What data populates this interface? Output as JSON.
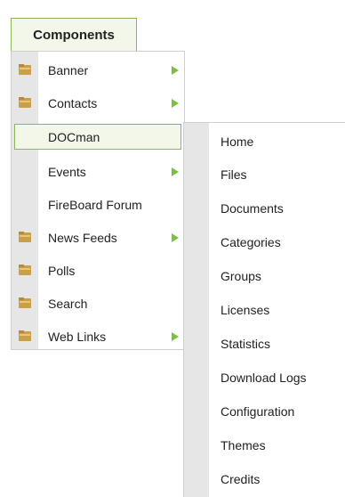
{
  "tab": {
    "label": "Components"
  },
  "menu": {
    "items": [
      {
        "label": "Banner",
        "icon": "folder-icon",
        "submenu": true
      },
      {
        "label": "Contacts",
        "icon": "folder-icon",
        "submenu": true
      },
      {
        "label": "DOCman",
        "icon": null,
        "submenu": false,
        "active": true
      },
      {
        "label": "Events",
        "icon": null,
        "submenu": true
      },
      {
        "label": "FireBoard Forum",
        "icon": null,
        "submenu": false
      },
      {
        "label": "News Feeds",
        "icon": "folder-icon",
        "submenu": true
      },
      {
        "label": "Polls",
        "icon": "folder-icon",
        "submenu": false
      },
      {
        "label": "Search",
        "icon": "folder-icon",
        "submenu": false
      },
      {
        "label": "Web Links",
        "icon": "folder-icon",
        "submenu": true
      }
    ]
  },
  "submenu": {
    "items": [
      {
        "label": "Home"
      },
      {
        "label": "Files"
      },
      {
        "label": "Documents"
      },
      {
        "label": "Categories"
      },
      {
        "label": "Groups"
      },
      {
        "label": "Licenses"
      },
      {
        "label": "Statistics"
      },
      {
        "label": "Download Logs"
      },
      {
        "label": "Configuration"
      },
      {
        "label": "Themes"
      },
      {
        "label": "Credits"
      }
    ]
  },
  "colors": {
    "accent_border": "#8ab45e",
    "active_bg": "#f2f7ea",
    "arrow": "#7cc040",
    "gutter": "#e6e6e6"
  }
}
